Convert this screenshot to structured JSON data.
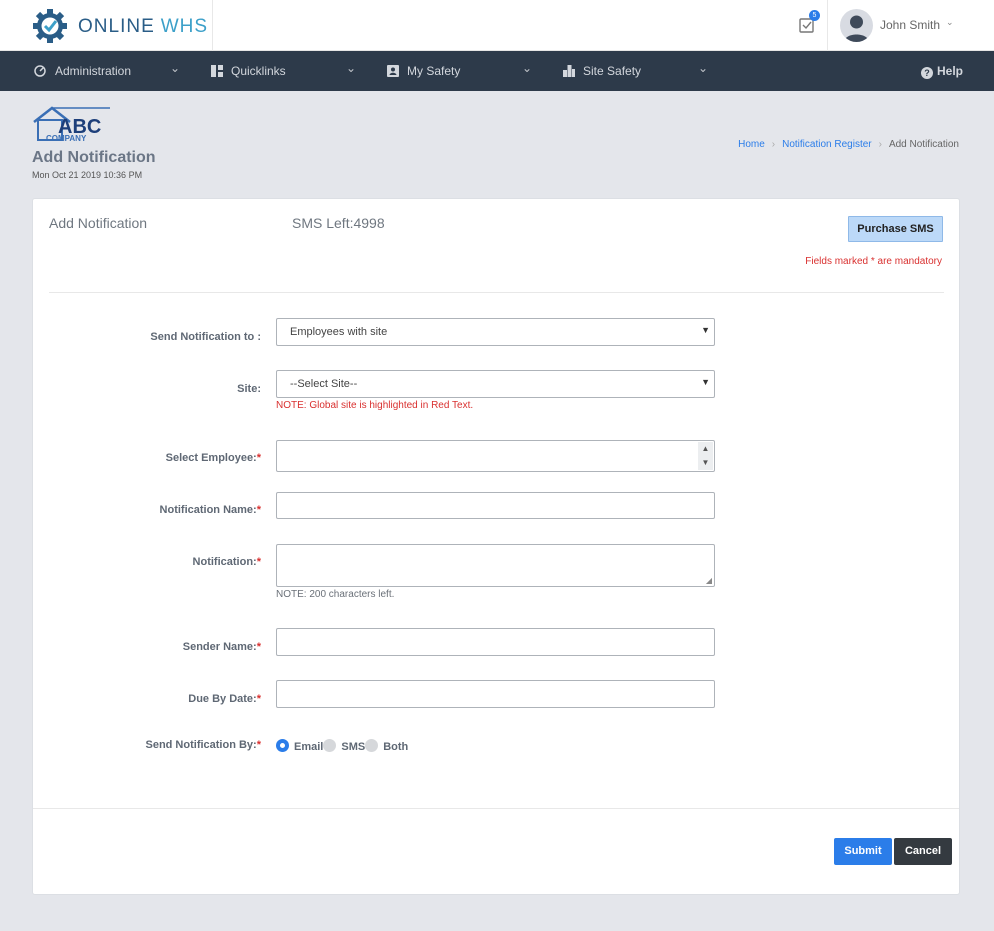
{
  "header": {
    "brand_part1": "ONLINE",
    "brand_part2": "WHS",
    "notification_count": "5",
    "user_name": "John Smith",
    "caret": "⌄"
  },
  "nav": {
    "items": [
      {
        "label": "Administration",
        "icon": "gauge-icon"
      },
      {
        "label": "Quicklinks",
        "icon": "grid-icon"
      },
      {
        "label": "My Safety",
        "icon": "id-card-icon"
      },
      {
        "label": "Site Safety",
        "icon": "buildings-icon"
      }
    ],
    "chevron": "⌄",
    "help_label": "Help"
  },
  "page": {
    "company_logo_text": "ABC",
    "company_logo_sub": "COMPANY",
    "title": "Add Notification",
    "date": "Mon Oct 21 2019 10:36 PM",
    "breadcrumb": [
      "Home",
      "Notification Register",
      "Add Notification"
    ],
    "breadcrumb_sep": "›"
  },
  "card": {
    "title": "Add Notification",
    "sms_left": "SMS Left:4998",
    "purchase_label": "Purchase SMS",
    "mandatory_note": "Fields marked * are mandatory"
  },
  "form": {
    "send_to_label": "Send Notification to :",
    "send_to_value": "Employees with site",
    "site_label": "Site:",
    "site_value": "--Select Site--",
    "site_note": "NOTE: Global site is highlighted in Red Text.",
    "employee_label": "Select Employee:",
    "name_label": "Notification Name:",
    "notification_label": "Notification:",
    "chars_note": "NOTE: 200 characters left.",
    "sender_label": "Sender Name:",
    "due_label": "Due By Date:",
    "send_by_label": "Send Notification By:",
    "required_mark": "*",
    "options": [
      {
        "label": "Email",
        "selected": true
      },
      {
        "label": "SMS",
        "selected": false
      },
      {
        "label": "Both",
        "selected": false
      }
    ]
  },
  "actions": {
    "submit_label": "Submit",
    "cancel_label": "Cancel"
  },
  "colors": {
    "navbar": "#2d3a4a",
    "accent": "#2b7de9",
    "danger": "#d9302f",
    "brand": "#2a5d87"
  }
}
